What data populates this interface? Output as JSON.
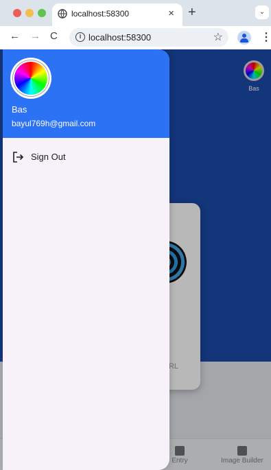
{
  "browser": {
    "tab_title": "localhost:58300",
    "tab_close": "×",
    "new_tab": "+",
    "tab_menu": "⌄",
    "url": "localhost:58300",
    "nav_back": "←",
    "nav_forward": "→",
    "nav_reload": "C",
    "star": "☆",
    "kebab": "⋮",
    "info": "i"
  },
  "app": {
    "header_avatar_label": "Bas",
    "card_label": "URL",
    "bottom_nav": [
      {
        "label": "Entry",
        "icon": "grid-icon"
      },
      {
        "label": "Image Builder",
        "icon": "paint-roller-icon"
      }
    ]
  },
  "drawer": {
    "user_name": "Bas",
    "user_email": "bayul769h@gmail.com",
    "items": [
      {
        "label": "Sign Out",
        "icon": "logout-icon"
      }
    ]
  },
  "colors": {
    "drawer_header": "#2b72f5",
    "app_header": "#1b4aa8",
    "drawer_bg": "#f7f2fa"
  }
}
